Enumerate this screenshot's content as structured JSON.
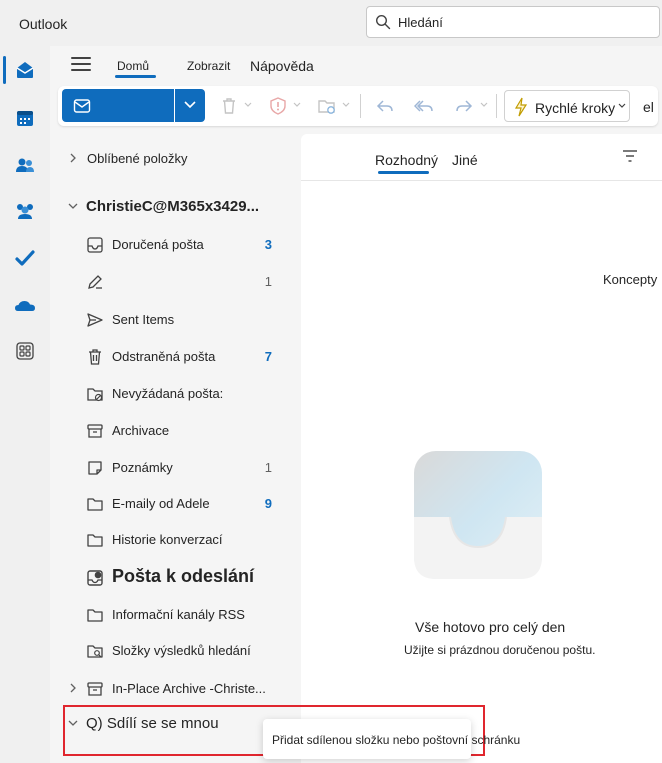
{
  "app": {
    "title": "Outlook"
  },
  "search": {
    "placeholder": "Hledání"
  },
  "menu": {
    "tabs": [
      "Domů",
      "Zobrazit",
      "Nápověda"
    ]
  },
  "ribbon": {
    "quick_steps": "Rychlé kroky",
    "more": "el"
  },
  "folders": {
    "favorites": "Oblíbené položky",
    "account": "ChristieC@M365x3429...",
    "items": [
      {
        "label": "Doručená pošta",
        "count": "3",
        "icon": "inbox-icon"
      },
      {
        "label": "",
        "count": "1",
        "icon": "draft-pencil-icon"
      },
      {
        "label": "Sent Items",
        "count": "",
        "icon": "send-icon"
      },
      {
        "label": "Odstraněná pošta",
        "count": "7",
        "icon": "trash-icon"
      },
      {
        "label": "Nevyžádaná pošta:",
        "count": "",
        "icon": "junk-folder-icon"
      },
      {
        "label": "Archivace",
        "count": "",
        "icon": "archive-icon"
      },
      {
        "label": "Poznámky",
        "count": "1",
        "icon": "note-icon"
      },
      {
        "label": "E-maily od Adele",
        "count": "9",
        "icon": "folder-icon"
      },
      {
        "label": "Historie konverzací",
        "count": "",
        "icon": "folder-icon"
      },
      {
        "label": "Pošta k odeslání",
        "count": "",
        "icon": "outbox-icon"
      },
      {
        "label": "Informační kanály RSS",
        "count": "",
        "icon": "folder-icon"
      },
      {
        "label": "Složky výsledků hledání",
        "count": "",
        "icon": "search-folder-icon"
      },
      {
        "label": "In-Place Archive -Christe...",
        "count": "",
        "icon": "archive-icon"
      }
    ],
    "shared": "Q) Sdílí se se mnou"
  },
  "message_list": {
    "tabs": [
      "Rozhodný",
      "Jiné"
    ],
    "drafts_tip": "Koncepty",
    "empty_title": "Vše hotovo pro celý den",
    "empty_subtitle": "Užijte si prázdnou doručenou poštu."
  },
  "tooltip": {
    "text": "Přidat sdílenou složku nebo poštovní schránku"
  },
  "colors": {
    "accent": "#0f6cbd",
    "highlight": "#e0262e"
  }
}
